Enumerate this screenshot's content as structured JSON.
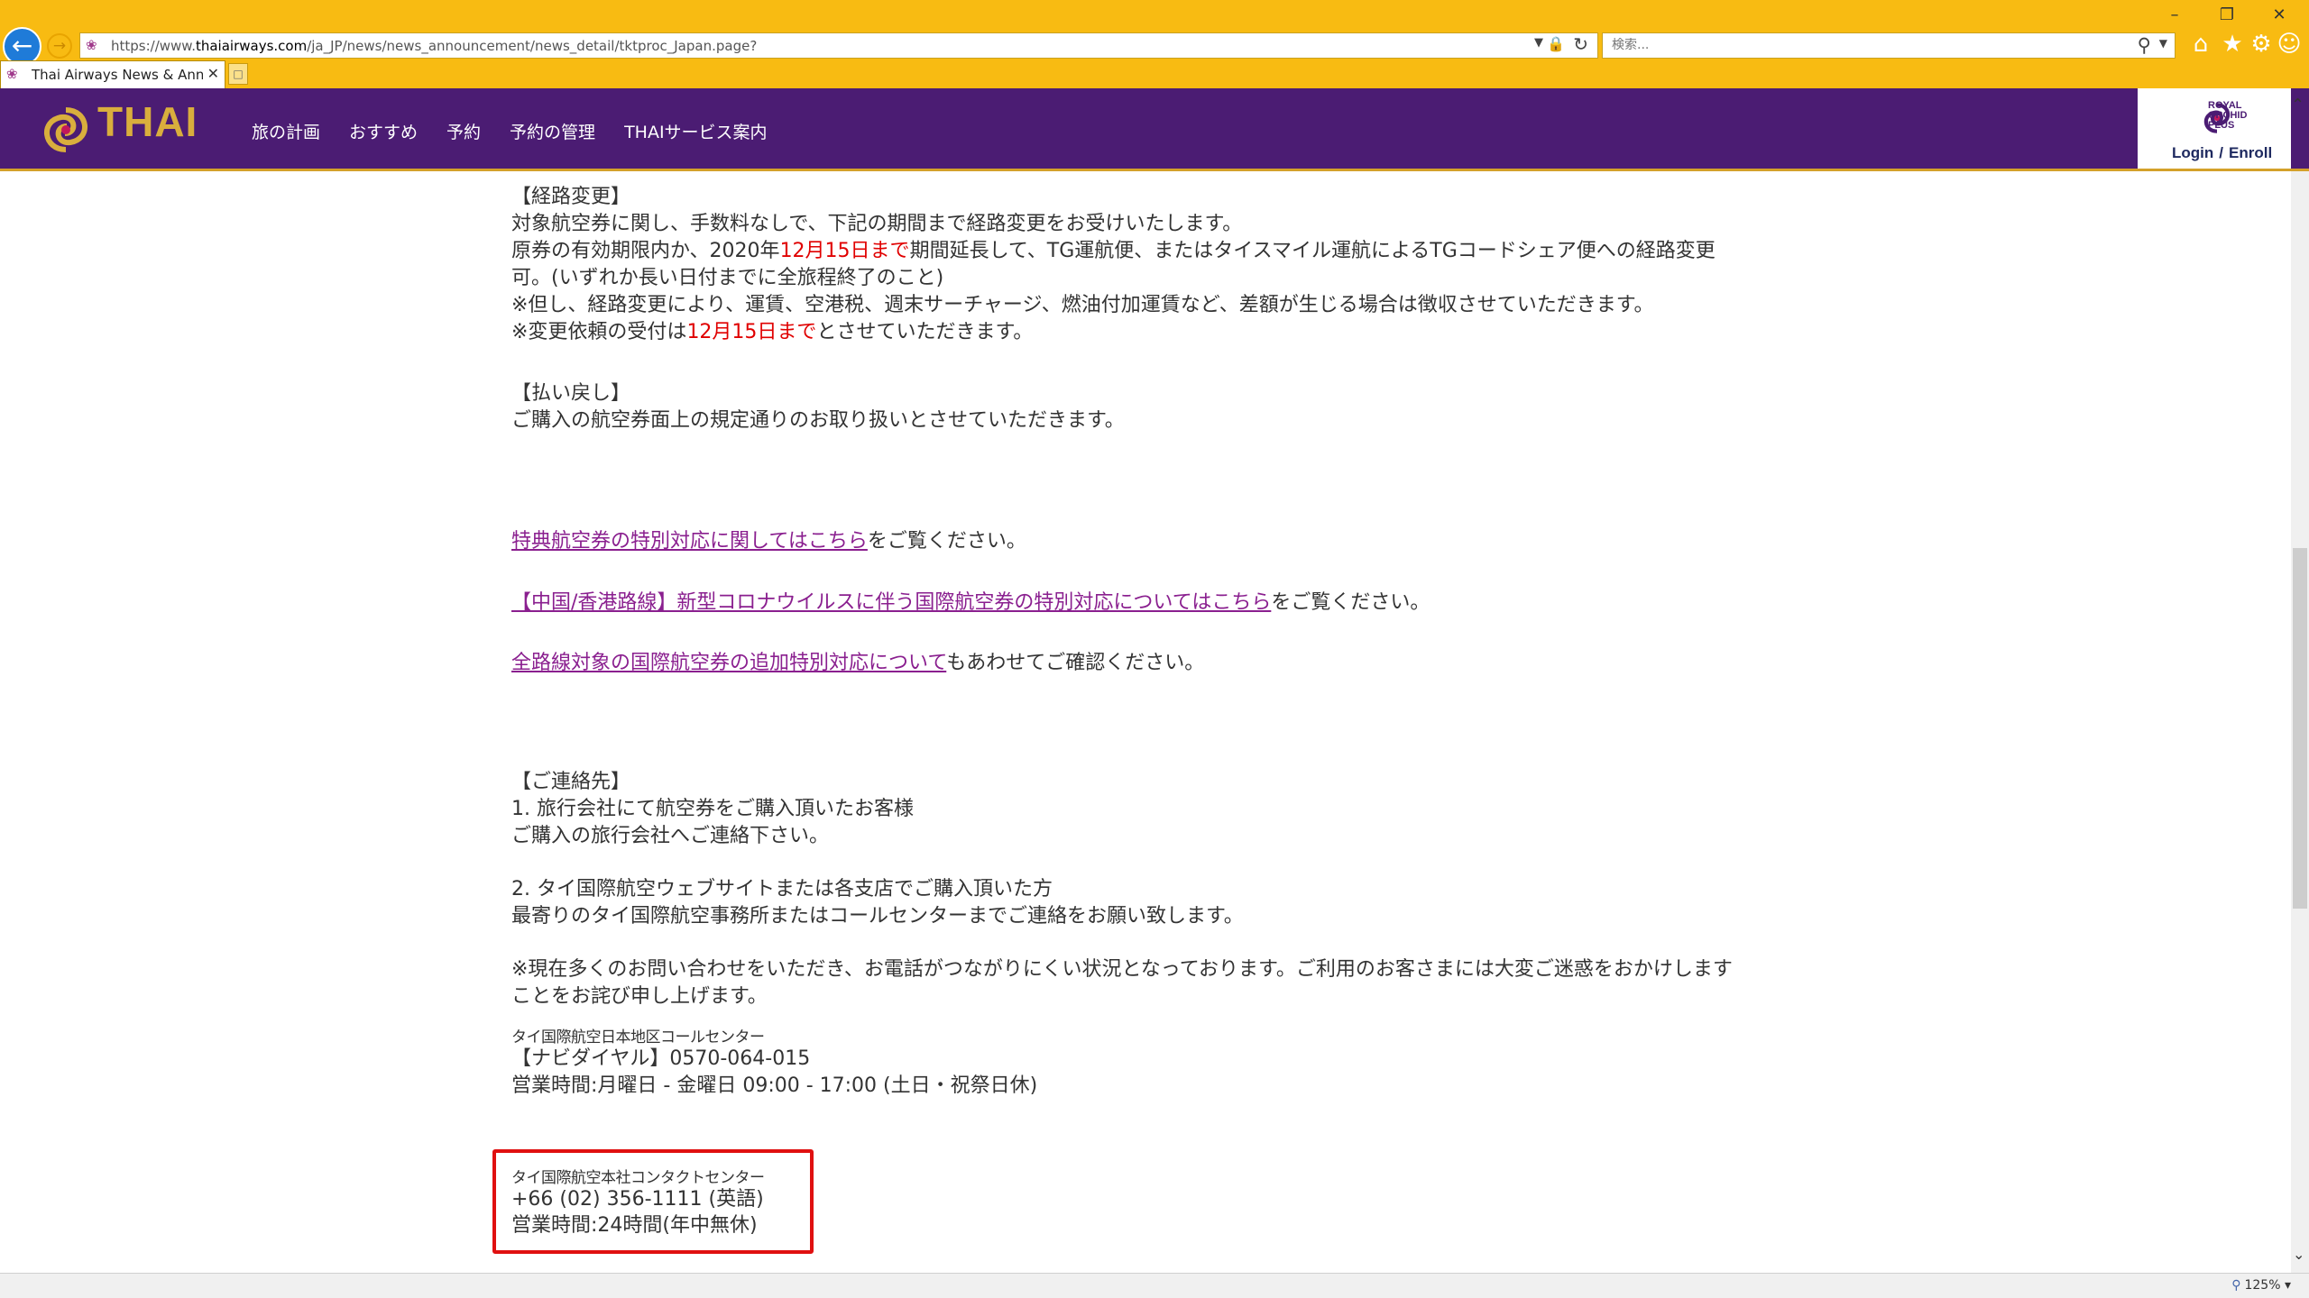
{
  "browser": {
    "url_prefix": "https://www.",
    "url_host": "thaiairways.com",
    "url_path": "/ja_JP/news/news_announcement/news_detail/tktproc_Japan.page?",
    "search_placeholder": "検索...",
    "tab_title": "Thai Airways News & Anno...",
    "zoom_level": "125%",
    "accent_color": "#f8bb12"
  },
  "site": {
    "logo_text": "THAI",
    "nav": [
      "旅の計画",
      "おすすめ",
      "予約",
      "予約の管理",
      "THAIサービス案内"
    ],
    "rop_lines": [
      "ROYAL",
      "ORCHID",
      "PLUS"
    ],
    "login_label": "Login",
    "separator": "/",
    "enroll_label": "Enroll",
    "header_color": "#4b1c73"
  },
  "content": {
    "route_change": {
      "heading": "【経路変更】",
      "line1": "対象航空券に関し、手数料なしで、下記の期間まで経路変更をお受けいたします。",
      "line2_pre": "原券の有効期限内か、2020年",
      "line2_red": "12月15日まで",
      "line2_post": "期間延長して、TG運航便、またはタイスマイル運航によるTGコードシェア便への経路変更",
      "line3": "可。(いずれか長い日付までに全旅程終了のこと)",
      "note1": "※但し、経路変更により、運賃、空港税、週末サーチャージ、燃油付加運賃など、差額が生じる場合は徴収させていただきます。",
      "note2_pre": "※変更依頼の受付は",
      "note2_red": "12月15日まで",
      "note2_post": "とさせていただきます。"
    },
    "refund": {
      "heading": "【払い戻し】",
      "line1": "ご購入の航空券面上の規定通りのお取り扱いとさせていただきます。"
    },
    "links": [
      {
        "link": "特典航空券の特別対応に関してはこちら",
        "suffix": "をご覧ください。"
      },
      {
        "link": "【中国/香港路線】新型コロナウイルスに伴う国際航空券の特別対応についてはこちら",
        "suffix": "をご覧ください。"
      },
      {
        "link": "全路線対象の国際航空券の追加特別対応について",
        "suffix": "もあわせてご確認ください。"
      }
    ],
    "contact": {
      "heading": "【ご連絡先】",
      "item1_title": "1. 旅行会社にて航空券をご購入頂いたお客様",
      "item1_body": "ご購入の旅行会社へご連絡下さい。",
      "item2_title": "2. タイ国際航空ウェブサイトまたは各支店でご購入頂いた方",
      "item2_body": "最寄りのタイ国際航空事務所またはコールセンターまでご連絡をお願い致します。",
      "notice_line1": "※現在多くのお問い合わせをいただき、お電話がつながりにくい状況となっております。ご利用のお客さまには大変ご迷惑をおかけします",
      "notice_line2": "ことをお詫び申し上げます。",
      "japan_center_label": "タイ国際航空日本地区コールセンター",
      "japan_center_phone": "【ナビダイヤル】0570-064-015",
      "japan_center_hours": "営業時間:月曜日 - 金曜日  09:00 - 17:00  (土日・祝祭日休)",
      "hq_center_label": "タイ国際航空本社コンタクトセンター",
      "hq_center_phone": "+66 (02) 356-1111 (英語)",
      "hq_center_hours": "営業時間:24時間(年中無休)"
    }
  }
}
